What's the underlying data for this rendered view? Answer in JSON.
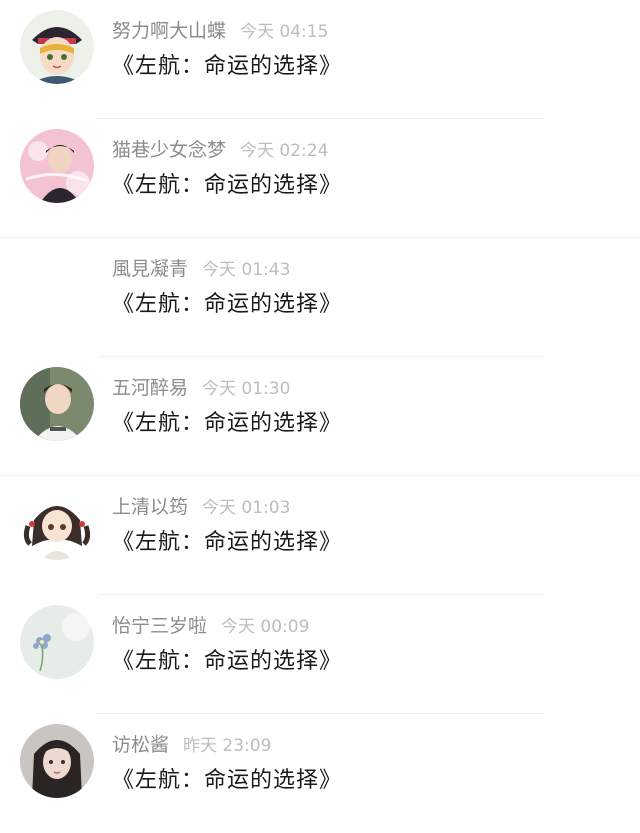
{
  "comments": [
    {
      "username": "努力啊大山蝶",
      "time": "今天 04:15",
      "message": "《左航：命运的选择》",
      "avatar": "avatar-anime-boy-hat-icon"
    },
    {
      "username": "猫巷少女念梦",
      "time": "今天 02:24",
      "message": "《左航：命运的选择》",
      "avatar": "avatar-pink-photo-icon"
    },
    {
      "username": "風見凝青",
      "time": "今天 01:43",
      "message": "《左航：命运的选择》",
      "avatar": ""
    },
    {
      "username": "五河醉易",
      "time": "今天 01:30",
      "message": "《左航：命运的选择》",
      "avatar": "avatar-boy-photo-icon"
    },
    {
      "username": "上清以筠",
      "time": "今天 01:03",
      "message": "《左航：命运的选择》",
      "avatar": "avatar-anime-girl-icon"
    },
    {
      "username": "怡宁三岁啦",
      "time": "今天 00:09",
      "message": "《左航：命运的选择》",
      "avatar": "avatar-flower-icon"
    },
    {
      "username": "访松酱",
      "time": "昨天 23:09",
      "message": "《左航：命运的选择》",
      "avatar": "avatar-girl-photo-icon"
    }
  ],
  "colors": {
    "username": "#8c8c8c",
    "time": "#bdbdbd",
    "message": "#1a1a1a",
    "divider": "#eeeeee",
    "background": "#ffffff"
  }
}
